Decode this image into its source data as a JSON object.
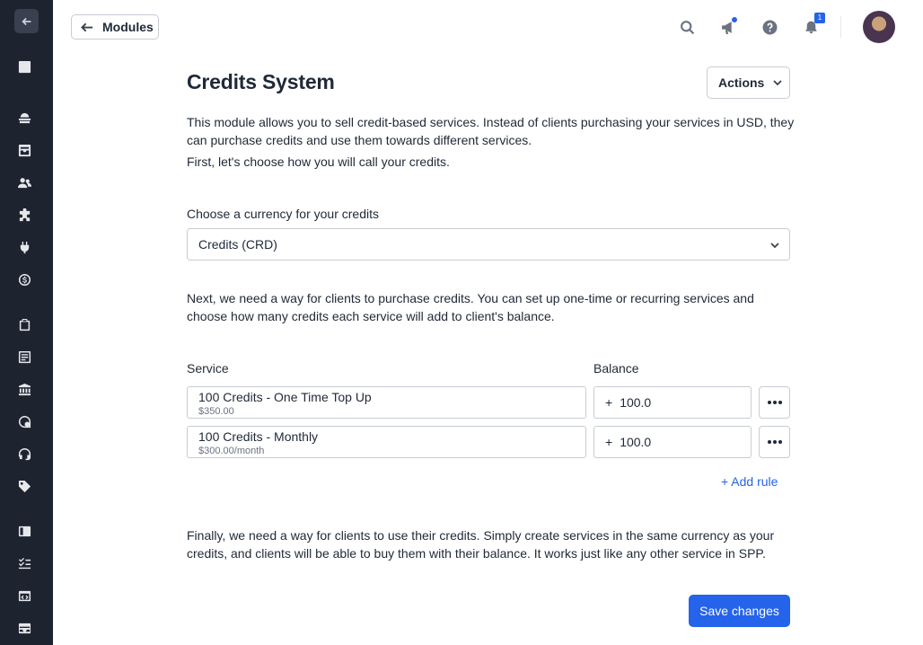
{
  "sidebar": {
    "back_icon": "arrow-left-icon",
    "items": [
      {
        "icon": "collapse-icon"
      },
      {
        "icon": "dashboard-icon"
      },
      {
        "icon": "inbox-icon"
      },
      {
        "icon": "clients-icon"
      },
      {
        "icon": "modules-icon"
      },
      {
        "icon": "plug-icon"
      },
      {
        "icon": "billing-icon"
      },
      {
        "icon": "clipboard-icon"
      },
      {
        "icon": "invoice-icon"
      },
      {
        "icon": "building-icon"
      },
      {
        "icon": "chat-icon"
      },
      {
        "icon": "support-icon"
      },
      {
        "icon": "tag-icon"
      },
      {
        "icon": "layout-icon"
      },
      {
        "icon": "tasks-icon"
      },
      {
        "icon": "code-icon"
      },
      {
        "icon": "mail-icon"
      }
    ]
  },
  "topbar": {
    "back_label": "Modules",
    "notification_count": "1"
  },
  "page": {
    "title": "Credits System",
    "actions_label": "Actions",
    "intro_1": "This module allows you to sell credit-based services. Instead of clients purchasing your services in USD, they can purchase credits and use them towards different services.",
    "intro_2": "First, let's choose how you will call your credits.",
    "currency_label": "Choose a currency for your credits",
    "currency_value": "Credits (CRD)",
    "next_text": "Next, we need a way for clients to purchase credits. You can set up one-time or recurring services and choose how many credits each service will add to client's balance.",
    "service_header": "Service",
    "balance_header": "Balance",
    "rules": [
      {
        "name": "100 Credits - One Time Top Up",
        "price": "$350.00",
        "plus": "+",
        "balance": "100.0"
      },
      {
        "name": "100 Credits - Monthly",
        "price": "$300.00/month",
        "plus": "+",
        "balance": "100.0"
      }
    ],
    "add_rule_label": "+ Add rule",
    "final_text": "Finally, we need a way for clients to use their credits. Simply create services in the same currency as your credits, and clients will be able to buy them with their balance. It works just like any other service in SPP.",
    "save_label": "Save changes"
  },
  "colors": {
    "sidebar_bg": "#1e2330",
    "accent": "#2563eb"
  }
}
